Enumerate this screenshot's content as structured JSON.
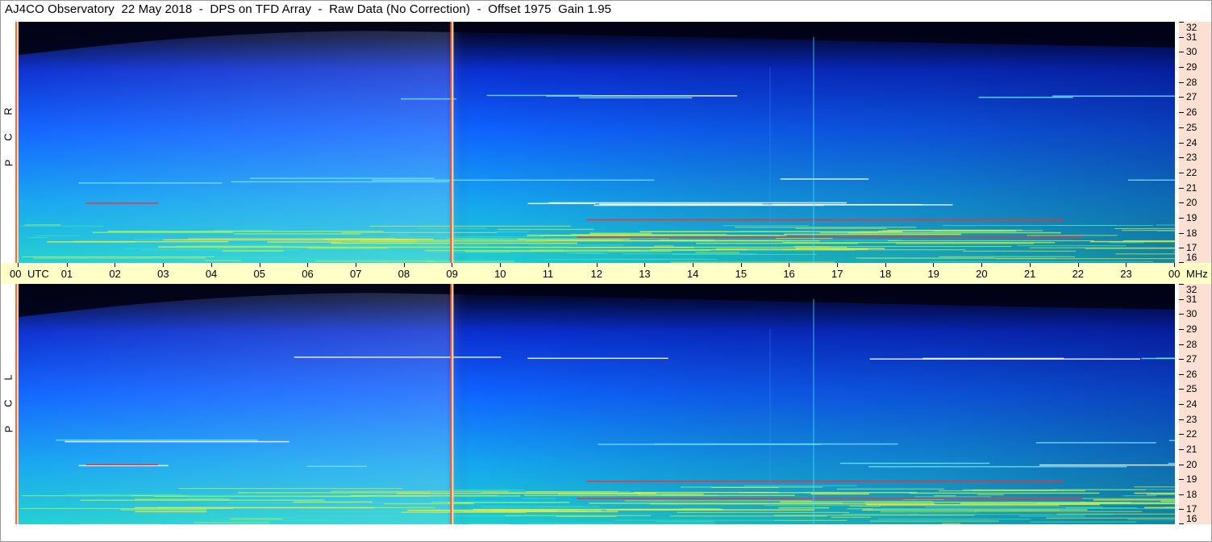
{
  "title": "AJ4CO Observatory  22 May 2018  -  DPS on TFD Array  -  Raw Data (No Correction)  -  Offset 1975  Gain 1.95",
  "panels": {
    "top": {
      "label_letters": [
        "R",
        "C",
        "P"
      ]
    },
    "bottom": {
      "label_letters": [
        "L",
        "C",
        "P"
      ]
    }
  },
  "time_axis": {
    "labels": [
      "00",
      "UTC",
      "01",
      "02",
      "03",
      "04",
      "05",
      "06",
      "07",
      "08",
      "09",
      "10",
      "11",
      "12",
      "13",
      "14",
      "15",
      "16",
      "17",
      "18",
      "19",
      "20",
      "21",
      "22",
      "23",
      "00",
      "MHz"
    ]
  },
  "colors": {
    "background_dark": "#02041a",
    "band_blue": "#0a3cff",
    "band_cyan": "#22d0d8",
    "noise_yellow": "#e8e840",
    "marker_red": "#ff2a2a",
    "time_bar_bg": "#ffffc8",
    "freq_strip_bg": "#fde0d4"
  },
  "chart_data": {
    "type": "heatmap",
    "title": "AJ4CO Observatory  22 May 2018  -  DPS on TFD Array  -  Raw Data (No Correction)  -  Offset 1975  Gain 1.95",
    "xlabel": "UTC",
    "ylabel": "MHz",
    "x_ticks": [
      "00",
      "01",
      "02",
      "03",
      "04",
      "05",
      "06",
      "07",
      "08",
      "09",
      "10",
      "11",
      "12",
      "13",
      "14",
      "15",
      "16",
      "17",
      "18",
      "19",
      "20",
      "21",
      "22",
      "23",
      "00"
    ],
    "xlim": [
      0,
      24
    ],
    "y_ticks": [
      32,
      31,
      30,
      29,
      28,
      27,
      26,
      25,
      24,
      23,
      22,
      21,
      20,
      19,
      18,
      17,
      16
    ],
    "ylim": [
      16,
      32
    ],
    "panels": [
      {
        "name": "RCP",
        "label": "R C P"
      },
      {
        "name": "LCP",
        "label": "L C P"
      }
    ],
    "day_boundary_utc": 9.0,
    "interference_bands_mhz": [
      17.0,
      17.5,
      18.0,
      20.0,
      21.5,
      27.0
    ],
    "grid": false
  }
}
